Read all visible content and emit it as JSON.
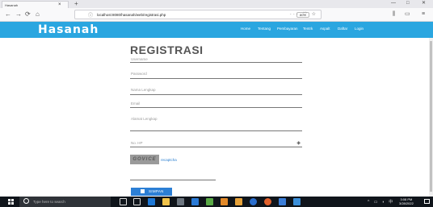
{
  "browser": {
    "tab_title": "Hasanah",
    "tab_close": "×",
    "new_tab": "+",
    "win_minimize": "—",
    "win_maximize": "□",
    "win_close": "✕",
    "back": "←",
    "forward": "→",
    "reload": "⟳",
    "home": "⌂",
    "url_info": "ⓘ",
    "url": "localhost:8080/hasanah/web/registrasi.php",
    "zoom": "80%",
    "url_actions": "··· ♡ ☆",
    "library": "⫼",
    "sidebar": "▭",
    "menu": "≡"
  },
  "site": {
    "logo": "Hasanah",
    "menu": [
      "Home",
      "Tentang",
      "Pembayaran",
      "Tentrk",
      "Aspalt",
      "Daftar",
      "Login"
    ]
  },
  "form": {
    "title": "REGISTRASI",
    "fields": {
      "username": "Username",
      "password": "Password",
      "nama_lengkap": "Nama Lengkap",
      "email": "Email",
      "alamat_lengkap": "Alamat Lengkap",
      "no_hp": "No. HP"
    },
    "captcha_text": "GOVICE",
    "captcha_refresh": "recaptcha",
    "submit_label": "SIMPAN"
  },
  "taskbar": {
    "search_placeholder": "Type here to search",
    "tray_icons": "^ ▭ ◗ 中",
    "time": "3:08 PM",
    "date": "3/28/2022"
  },
  "colors": {
    "header": "#2aa6e0",
    "submit": "#2c7fd5",
    "taskbar": "#10151b"
  }
}
